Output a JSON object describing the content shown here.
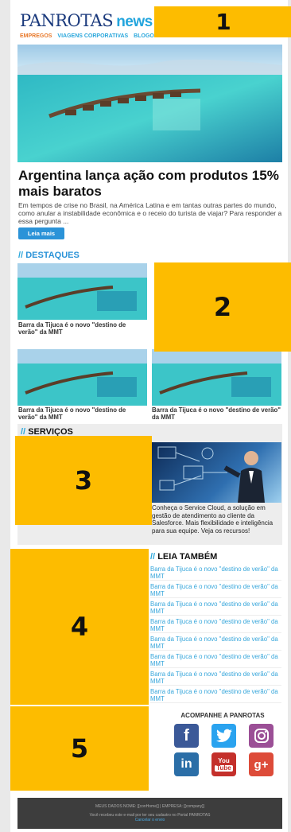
{
  "header": {
    "logo_main": "PANROTAS",
    "logo_news": "news",
    "nav": [
      "EMPREGOS",
      "VIAGENS CORPORATIVAS",
      "BLOGOS"
    ]
  },
  "hero_article": {
    "title": "Argentina lança ação com produtos 15% mais baratos",
    "lead": "Em tempos de crise no Brasil, na América Latina e em tantas outras partes do mundo, como anular a instabilidade econômica e o receio do turista de viajar? Para responder a essa pergunta ...",
    "button": "Leia mais"
  },
  "destaques": {
    "slash": "//",
    "title": "DESTAQUES",
    "items": [
      {
        "caption": "Barra da Tijuca é o novo \"destino de verão\" da MMT"
      },
      {
        "caption": "Barra da Tijuca é o novo \"destino de verão\" da MMT"
      },
      {
        "caption": "Barra da Tijuca é o novo \"destino de verão\" da MMT"
      }
    ]
  },
  "servicos": {
    "slash": "//",
    "title": "SERVIÇOS",
    "text": "Conheça o Service Cloud, a solução em gestão de atendimento ao cliente da Salesforce. Mais flexibilidade e inteligência para sua equipe. Veja os recursos!"
  },
  "leia_tambem": {
    "slash": "//",
    "title": "LEIA TAMBÉM",
    "links": [
      "Barra da Tijuca é o novo \"destino de verão\" da MMT",
      "Barra da Tijuca é o novo \"destino de verão\" da MMT",
      "Barra da Tijuca é o novo \"destino de verão\" da MMT",
      "Barra da Tijuca é o novo \"destino de verão\" da MMT",
      "Barra da Tijuca é o novo \"destino de verão\" da MMT",
      "Barra da Tijuca é o novo \"destino de verão\" da MMT",
      "Barra da Tijuca é o novo \"destino de verão\" da MMT",
      "Barra da Tijuca é o novo \"destino de verão\" da MMT"
    ]
  },
  "social": {
    "title": "ACOMPANHE A PANROTAS",
    "icons": [
      "facebook-icon",
      "twitter-icon",
      "instagram-icon",
      "linkedin-icon",
      "youtube-icon",
      "google-plus-icon"
    ],
    "glyphs": {
      "facebook": "f",
      "linkedin": "in",
      "youtube_top": "You",
      "youtube_bottom": "Tube",
      "google_plus": "g+"
    },
    "colors": {
      "facebook": "#3b5998",
      "twitter": "#2aa3ef",
      "instagram": "#9b4f96",
      "linkedin": "#2b6ea7",
      "youtube": "#c4302b",
      "google_plus": "#dd4b39"
    }
  },
  "footer": {
    "line1": "MEUS DADOS NOME: [[conHome]] | EMPRESA: [[company]]",
    "line2": "Você recebeu este e-mail por ter seu cadastro no Portal PANROTAS",
    "line3": "Cancelar o envio"
  },
  "overlays": [
    "1",
    "2",
    "3",
    "4",
    "5"
  ],
  "colors": {
    "overlay": "#fdbc00",
    "accent": "#2aa7dc",
    "brand": "#1c3b7d"
  }
}
